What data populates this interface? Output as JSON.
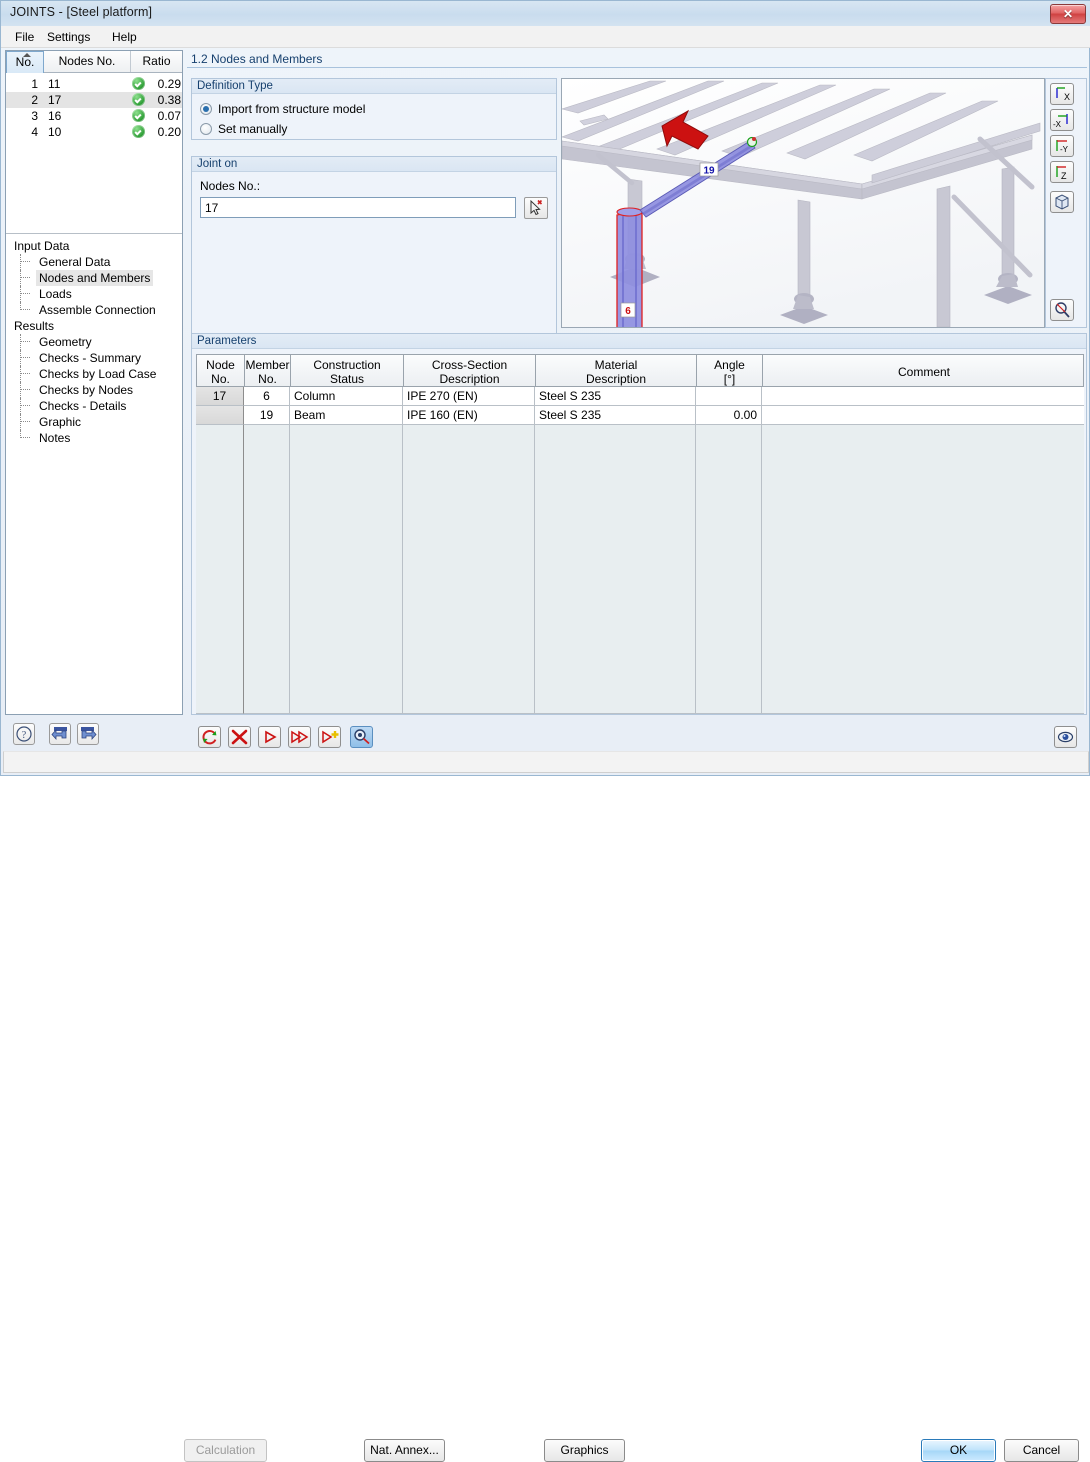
{
  "window": {
    "title": "JOINTS - [Steel platform]",
    "close_label": "✕"
  },
  "menu": {
    "items": [
      {
        "label": "File"
      },
      {
        "label": "Settings"
      },
      {
        "label": "Help"
      }
    ]
  },
  "left_panel": {
    "table": {
      "columns": [
        "No.",
        "Nodes No.",
        "Ratio"
      ],
      "rows": [
        {
          "no": "1",
          "nodes_no": "11",
          "ratio": "0.29",
          "status": "ok",
          "selected": false
        },
        {
          "no": "2",
          "nodes_no": "17",
          "ratio": "0.38",
          "status": "ok",
          "selected": true
        },
        {
          "no": "3",
          "nodes_no": "16",
          "ratio": "0.07",
          "status": "ok",
          "selected": false
        },
        {
          "no": "4",
          "nodes_no": "10",
          "ratio": "0.20",
          "status": "ok",
          "selected": false
        }
      ]
    },
    "tree": {
      "groups": [
        {
          "label": "Input Data",
          "items": [
            {
              "label": "General Data",
              "selected": false
            },
            {
              "label": "Nodes and Members",
              "selected": true
            },
            {
              "label": "Loads",
              "selected": false
            },
            {
              "label": "Assemble Connection",
              "selected": false
            }
          ]
        },
        {
          "label": "Results",
          "items": [
            {
              "label": "Geometry",
              "selected": false
            },
            {
              "label": "Checks - Summary",
              "selected": false
            },
            {
              "label": "Checks by Load Case",
              "selected": false
            },
            {
              "label": "Checks by Nodes",
              "selected": false
            },
            {
              "label": "Checks - Details",
              "selected": false
            },
            {
              "label": "Graphic",
              "selected": false
            },
            {
              "label": "Notes",
              "selected": false
            }
          ]
        }
      ]
    },
    "buttons": [
      {
        "name": "help-button",
        "icon": "question-icon"
      },
      {
        "name": "previous-button",
        "icon": "arrow-left-icon"
      },
      {
        "name": "next-button",
        "icon": "arrow-right-icon"
      }
    ]
  },
  "main": {
    "section_title": "1.2 Nodes and Members",
    "definition_type": {
      "title": "Definition Type",
      "options": [
        {
          "label": "Import from structure model",
          "selected": true
        },
        {
          "label": "Set manually",
          "selected": false
        }
      ]
    },
    "joint_on": {
      "title": "Joint on",
      "field_label": "Nodes No.:",
      "value": "17",
      "placeholder": ""
    },
    "parameters": {
      "title": "Parameters",
      "columns": [
        {
          "line1": "Node",
          "line2": "No."
        },
        {
          "line1": "Member",
          "line2": "No."
        },
        {
          "line1": "Construction",
          "line2": "Status"
        },
        {
          "line1": "Cross-Section",
          "line2": "Description"
        },
        {
          "line1": "Material",
          "line2": "Description"
        },
        {
          "line1": "Angle",
          "line2": "[°]"
        },
        {
          "line1": "Comment",
          "line2": ""
        }
      ],
      "rows": [
        {
          "node_no": "17",
          "member_no": "6",
          "construction_status": "Column",
          "cross_section": "IPE 270 (EN)",
          "material": "Steel S 235",
          "angle": "",
          "comment": ""
        },
        {
          "node_no": "",
          "member_no": "19",
          "construction_status": "Beam",
          "cross_section": "IPE 160 (EN)",
          "material": "Steel S 235",
          "angle": "0.00",
          "comment": ""
        }
      ],
      "toolbar": [
        {
          "name": "refresh-button",
          "icon": "refresh-icon"
        },
        {
          "name": "delete-button",
          "icon": "red-x-icon"
        },
        {
          "name": "run-button",
          "icon": "play-icon"
        },
        {
          "name": "run-all-button",
          "icon": "fast-forward-icon"
        },
        {
          "name": "add-button",
          "icon": "play-plus-icon"
        },
        {
          "name": "select-graphically-button",
          "icon": "pointer-pick-icon"
        }
      ],
      "view_button": {
        "name": "visibility-button",
        "icon": "eye-icon"
      }
    }
  },
  "viewport": {
    "labels": {
      "member_beam": "19",
      "member_column": "6"
    },
    "axes": {
      "x": "X",
      "y": "Y",
      "z": "Z"
    },
    "colors": {
      "structure": "#c9c9d2",
      "highlight_member": "#8e8ee0",
      "highlight_outline": "#e02020",
      "axis_x": "#e02020",
      "axis_y": "#18c018",
      "axis_z": "#2020e0",
      "arrow": "#cc1111"
    },
    "tools": [
      {
        "name": "view-x-button",
        "label": "X"
      },
      {
        "name": "view-negative-x-button",
        "label": "-X"
      },
      {
        "name": "view-negative-y-button",
        "label": "-Y"
      },
      {
        "name": "view-z-button",
        "label": "Z"
      },
      {
        "name": "view-isometric-button",
        "label": ""
      },
      {
        "name": "zoom-button",
        "label": ""
      }
    ]
  },
  "footer": {
    "calculation_label": "Calculation",
    "nat_annex_label": "Nat. Annex...",
    "graphics_label": "Graphics",
    "ok_label": "OK",
    "cancel_label": "Cancel"
  }
}
